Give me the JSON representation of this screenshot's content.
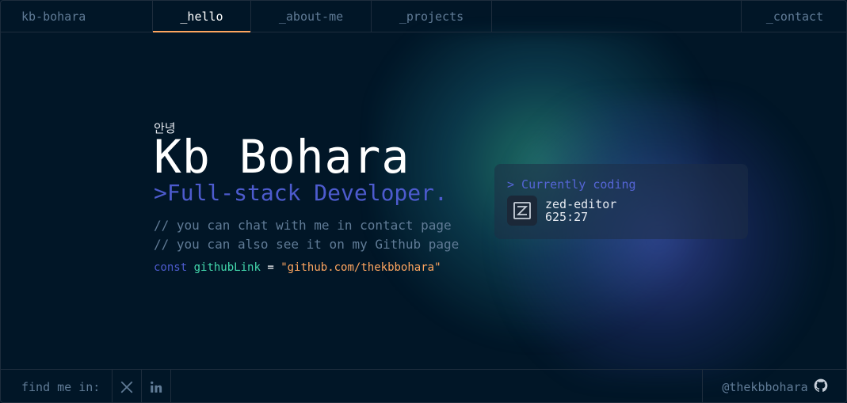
{
  "header": {
    "brand": "kb-bohara",
    "tabs": [
      {
        "label": "_hello",
        "active": true
      },
      {
        "label": "_about-me",
        "active": false
      },
      {
        "label": "_projects",
        "active": false
      }
    ],
    "contact": "_contact"
  },
  "hero": {
    "greeting": "안녕",
    "name": "Kb Bohara",
    "role": ">Full-stack Developer.",
    "comment1": "// you can chat with me in contact page",
    "comment2": "// you can also see it on my Github page",
    "code": {
      "keyword": "const",
      "variable": "githubLink",
      "equals": "=",
      "value": "\"github.com/thekbbohara\""
    }
  },
  "status": {
    "title": "> Currently coding",
    "app": "zed-editor",
    "position": "625:27",
    "icon": "zed-icon"
  },
  "footer": {
    "find_label": "find me in:",
    "socials": [
      "x-icon",
      "linkedin-icon"
    ],
    "handle": "@thekbbohara",
    "handle_icon": "github-icon"
  },
  "colors": {
    "background": "#011627",
    "border": "#1e2d3d",
    "text": "#607b96",
    "accent_orange": "#fea55f",
    "accent_blue": "#4d5bce",
    "accent_green": "#43d9ad"
  }
}
